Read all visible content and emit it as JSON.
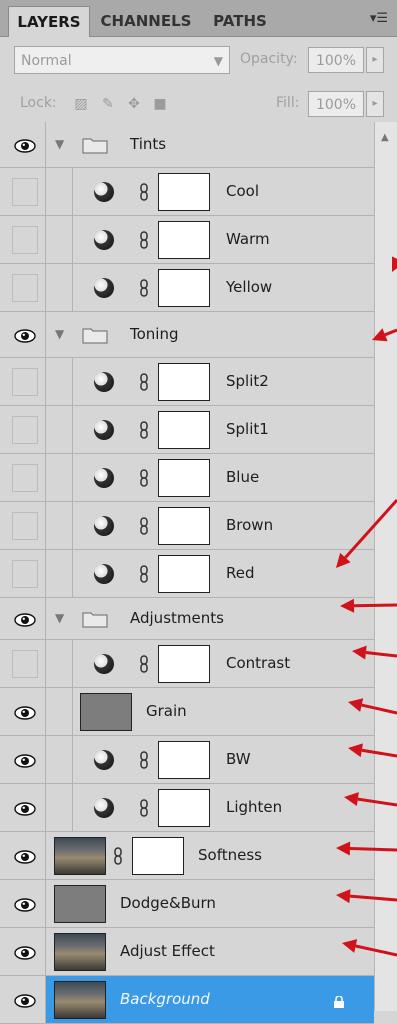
{
  "tabs": [
    {
      "label": "LAYERS",
      "active": true
    },
    {
      "label": "CHANNELS",
      "active": false
    },
    {
      "label": "PATHS",
      "active": false
    }
  ],
  "panel_menu_icon": "panel-menu-icon",
  "blend": {
    "mode": "Normal",
    "opacity_label": "Opacity:",
    "opacity_value": "100%"
  },
  "lock": {
    "label": "Lock:",
    "fill_label": "Fill:",
    "fill_value": "100%"
  },
  "layers": [
    {
      "name": "Tints",
      "type": "group",
      "visible": true
    },
    {
      "name": "Cool",
      "type": "adjustment",
      "visible": false,
      "indent": 1
    },
    {
      "name": "Warm",
      "type": "adjustment",
      "visible": false,
      "indent": 1
    },
    {
      "name": "Yellow",
      "type": "adjustment",
      "visible": false,
      "indent": 1
    },
    {
      "name": "Toning",
      "type": "group",
      "visible": true
    },
    {
      "name": "Split2",
      "type": "adjustment",
      "visible": false,
      "indent": 1
    },
    {
      "name": "Split1",
      "type": "adjustment",
      "visible": false,
      "indent": 1
    },
    {
      "name": "Blue",
      "type": "adjustment",
      "visible": false,
      "indent": 1
    },
    {
      "name": "Brown",
      "type": "adjustment",
      "visible": false,
      "indent": 1
    },
    {
      "name": "Red",
      "type": "adjustment",
      "visible": false,
      "indent": 1
    },
    {
      "name": "Adjustments",
      "type": "group",
      "visible": true
    },
    {
      "name": "Contrast",
      "type": "adjustment",
      "visible": false,
      "indent": 1
    },
    {
      "name": "Grain",
      "type": "pixel-gray",
      "visible": true,
      "indent": 1
    },
    {
      "name": "BW",
      "type": "adjustment",
      "visible": true,
      "indent": 1
    },
    {
      "name": "Lighten",
      "type": "adjustment",
      "visible": true,
      "indent": 1
    },
    {
      "name": "Softness",
      "type": "photo-mask",
      "visible": true
    },
    {
      "name": "Dodge&Burn",
      "type": "pixel-gray",
      "visible": true
    },
    {
      "name": "Adjust Effect",
      "type": "photo",
      "visible": true
    },
    {
      "name": "Background",
      "type": "background",
      "visible": true,
      "locked": true,
      "selected": true
    }
  ],
  "colors": {
    "panel": "#d6d6d6",
    "tab_bar": "#a9a9a9",
    "selected": "#3a9ae6",
    "arrow": "#d0121b"
  }
}
